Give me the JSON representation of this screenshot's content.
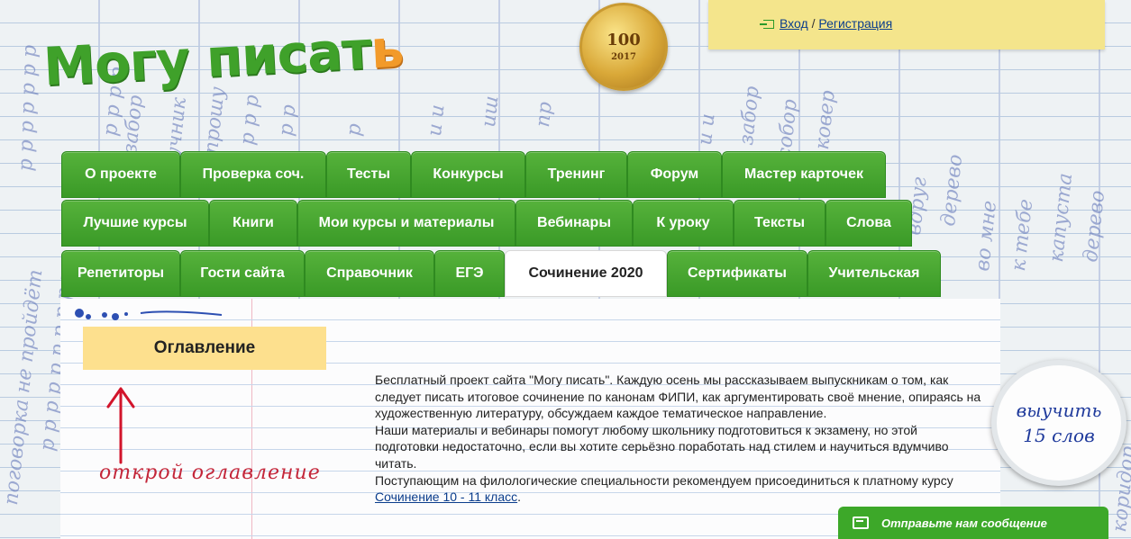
{
  "header": {
    "logo_main": "Могу писат",
    "logo_last": "ь",
    "medal_number": "100",
    "medal_year": "2017",
    "login_label": "Вход",
    "separator": "/",
    "register_label": "Регистрация"
  },
  "nav": {
    "row1": [
      "О проекте",
      "Проверка соч.",
      "Тесты",
      "Конкурсы",
      "Тренинг",
      "Форум",
      "Мастер карточек"
    ],
    "row2": [
      "Лучшие курсы",
      "Книги",
      "Мои курсы и материалы",
      "Вебинары",
      "К уроку",
      "Тексты",
      "Слова"
    ],
    "row3": [
      "Репетиторы",
      "Гости сайта",
      "Справочник",
      "ЕГЭ",
      "Сочинение 2020",
      "Сертификаты",
      "Учительская"
    ],
    "active": "Сочинение 2020"
  },
  "toc": {
    "button_label": "Оглавление",
    "hint": "открой оглавление"
  },
  "lead": {
    "p1": "Бесплатный проект сайта \"Могу писать\". Каждую осень мы рассказываем выпускникам о том, как следует писать итоговое сочинение по канонам ФИПИ, как аргументировать своё мнение, опираясь на художественную литературу, обсуждаем каждое тематическое направление.",
    "p2": "Наши материалы и вебинары помогут любому школьнику подготовиться к экзамену, но этой подготовки недостаточно, если вы хотите серьёзно поработать над стилем и научиться вдумчиво читать.",
    "p3": "Поступающим на филологические специальности рекомендуем присоединиться к платному курсу",
    "link": "Сочинение 10 - 11 класс",
    "link_suffix": "."
  },
  "badge": {
    "line1": "выучить",
    "line2": "15 слов"
  },
  "chat": {
    "label": "Отправьте нам сообщение"
  },
  "colors": {
    "tab_green": "#3a9a27",
    "logo_green": "#3fa12a",
    "logo_orange": "#f29a2a",
    "toc_yellow": "#fde08e",
    "note_yellow": "#f4e58c",
    "hint_red": "#c3263a",
    "link_blue": "#0b3d8c"
  },
  "icons": [
    "login-icon",
    "arrow-up-icon",
    "chat-icon",
    "ink-blot-icon"
  ]
}
